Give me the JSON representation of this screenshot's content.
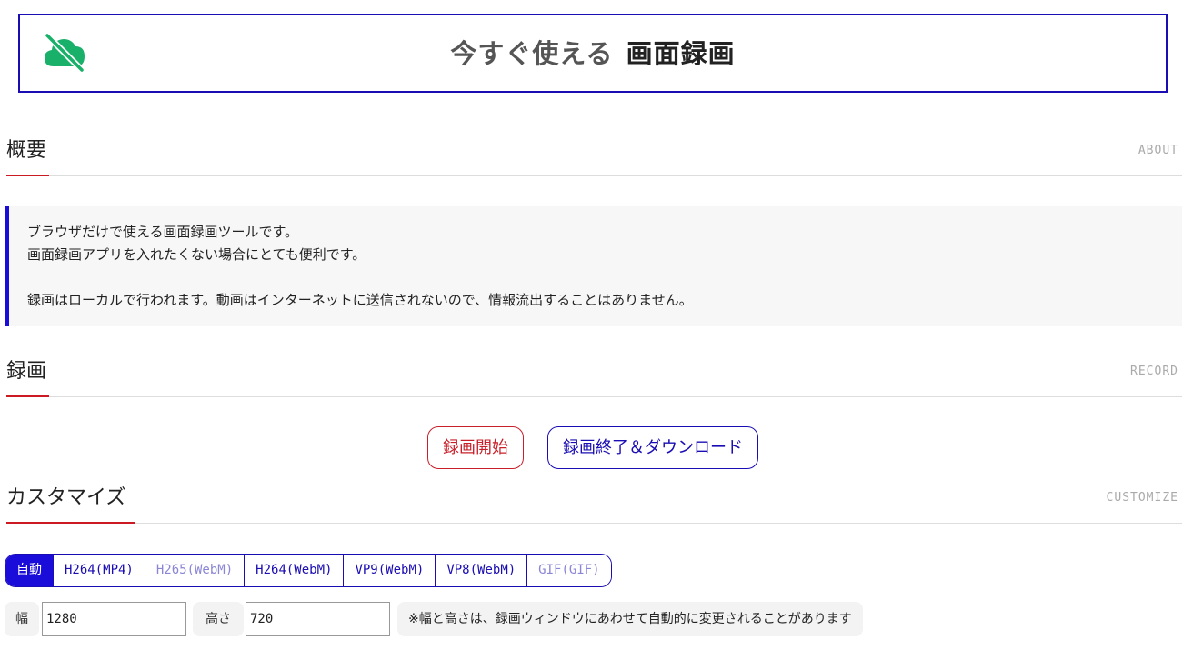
{
  "header": {
    "logo_icon": "cloud-off-icon",
    "title_light": "今すぐ使える",
    "title_strong": "画面録画"
  },
  "about": {
    "heading": "概要",
    "heading_en": "ABOUT",
    "lines": [
      "ブラウザだけで使える画面録画ツールです。",
      "画面録画アプリを入れたくない場合にとても便利です。",
      "",
      "録画はローカルで行われます。動画はインターネットに送信されないので、情報流出することはありません。"
    ]
  },
  "record": {
    "heading": "録画",
    "heading_en": "RECORD",
    "start_label": "録画開始",
    "stop_label": "録画終了＆ダウンロード"
  },
  "customize": {
    "heading": "カスタマイズ",
    "heading_en": "CUSTOMIZE",
    "codecs": [
      "自動",
      "H264(MP4)",
      "H265(WebM)",
      "H264(WebM)",
      "VP9(WebM)",
      "VP8(WebM)",
      "GIF(GIF)"
    ],
    "width_label": "幅",
    "width_value": "1280",
    "height_label": "高さ",
    "height_value": "720",
    "size_note": "※幅と高さは、録画ウィンドウにあわせて自動的に変更されることがあります"
  },
  "colors": {
    "accent_blue": "#1a0db3",
    "accent_red": "#c8202b",
    "logo_green": "#19b06a"
  }
}
